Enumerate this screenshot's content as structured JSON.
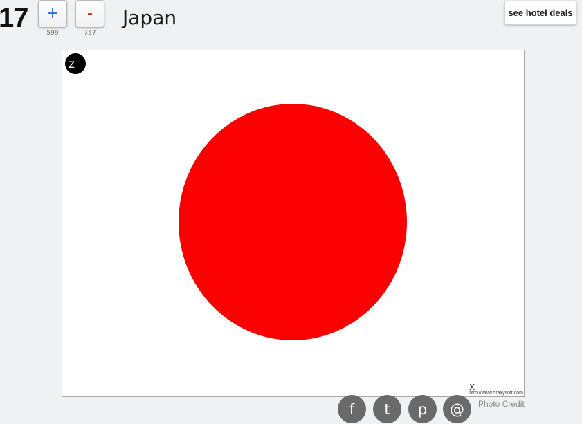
{
  "item": {
    "rank": "17",
    "title": "Japan"
  },
  "votes": {
    "up_label": "+",
    "up_count": "599",
    "down_label": "-",
    "down_count": "757"
  },
  "hotel_button": {
    "label": "see hotel deals"
  },
  "photo": {
    "zoom_label": "z",
    "watermark": "http://www.draxysoft.com",
    "close_label": "X",
    "credit_label": "Photo Credit",
    "colors": {
      "background": "#ffffff",
      "disc": "#fb0000"
    }
  },
  "share": {
    "facebook": "f",
    "twitter": "t",
    "pinterest": "p",
    "email": "@"
  },
  "colors": {
    "page_background": "#f0f1f2",
    "upvote": "#2a6fcf",
    "downvote": "#c91a1a",
    "share_button": "#6a6a6a"
  },
  "icons": {
    "zoom": "zoom-icon",
    "facebook": "facebook-icon",
    "twitter": "twitter-icon",
    "pinterest": "pinterest-icon",
    "email": "email-icon"
  }
}
